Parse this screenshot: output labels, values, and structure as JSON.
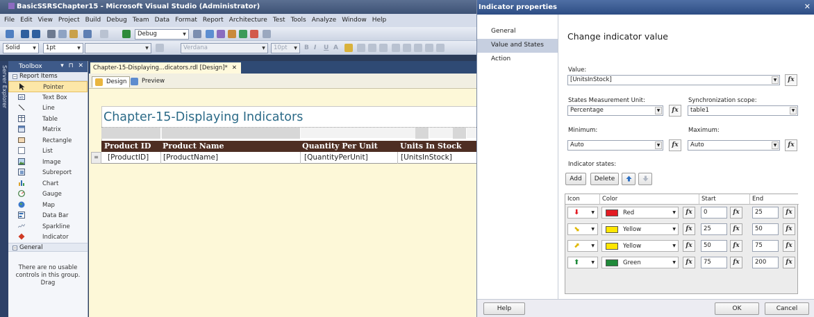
{
  "vs": {
    "title": "BasicSSRSChapter15 - Microsoft Visual Studio (Administrator)",
    "menu": [
      "File",
      "Edit",
      "View",
      "Project",
      "Build",
      "Debug",
      "Team",
      "Data",
      "Format",
      "Report",
      "Architecture",
      "Test",
      "Tools",
      "Analyze",
      "Window",
      "Help"
    ],
    "toolbar": {
      "config": "Debug",
      "border_style": "Solid",
      "border_width": "1pt",
      "font": "Verdana",
      "font_size": "10pt",
      "bold": "B",
      "italic": "I",
      "underline": "U",
      "font_color": "A"
    },
    "server_explorer": "Server Explorer",
    "toolbox": {
      "title": "Toolbox",
      "pins": "▾ ⊓ ✕",
      "group_report_items": "Report Items",
      "items": [
        "Pointer",
        "Text Box",
        "Line",
        "Table",
        "Matrix",
        "Rectangle",
        "List",
        "Image",
        "Subreport",
        "Chart",
        "Gauge",
        "Map",
        "Data Bar",
        "Sparkline",
        "Indicator"
      ],
      "group_general": "General",
      "general_empty_text": "There are no usable controls in this group. Drag"
    },
    "doc_tab": {
      "label": "Chapter-15-Displaying...dicators.rdl [Design]*",
      "close": "✕"
    },
    "design_tab": "Design",
    "preview_tab": "Preview",
    "report": {
      "title": "Chapter-15-Displaying Indicators",
      "headers": [
        "Product ID",
        "Product Name",
        "Quantity Per Unit",
        "Units In Stock"
      ],
      "row": [
        "[ProductID]",
        "[ProductName]",
        "[QuantityPerUnit]",
        "[UnitsInStock]"
      ]
    }
  },
  "dialog": {
    "title": "Indicator properties",
    "close": "✕",
    "nav": [
      "General",
      "Value and States",
      "Action"
    ],
    "heading": "Change indicator value",
    "value_label": "Value:",
    "value": "[UnitsInStock]",
    "unit_label": "States Measurement Unit:",
    "unit": "Percentage",
    "sync_label": "Synchronization scope:",
    "sync": "table1",
    "min_label": "Minimum:",
    "min": "Auto",
    "max_label": "Maximum:",
    "max": "Auto",
    "fx": "fx",
    "states_label": "Indicator states:",
    "add": "Add",
    "delete": "Delete",
    "columns": [
      "Icon",
      "Color",
      "Start",
      "End"
    ],
    "states": [
      {
        "icon": "red-down-arrow",
        "color_name": "Red",
        "swatch": "#e31b23",
        "start": "0",
        "end": "25"
      },
      {
        "icon": "yellow-down-right-arrow",
        "color_name": "Yellow",
        "swatch": "#ffe600",
        "start": "25",
        "end": "50"
      },
      {
        "icon": "yellow-up-right-arrow",
        "color_name": "Yellow",
        "swatch": "#ffe600",
        "start": "50",
        "end": "75"
      },
      {
        "icon": "green-up-arrow",
        "color_name": "Green",
        "swatch": "#1f8a3a",
        "start": "75",
        "end": "200"
      }
    ],
    "help": "Help",
    "ok": "OK",
    "cancel": "Cancel"
  }
}
